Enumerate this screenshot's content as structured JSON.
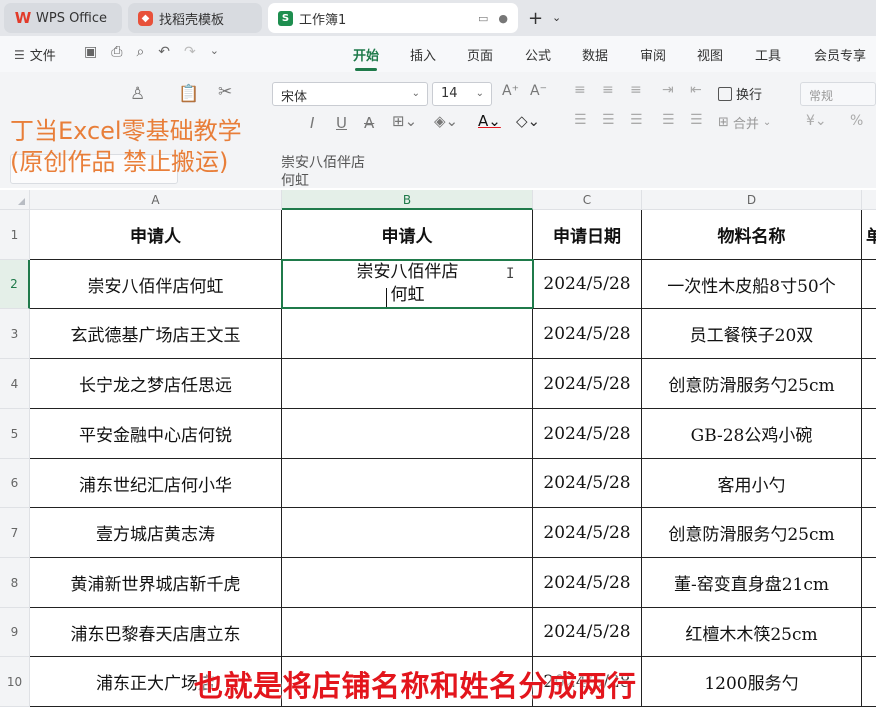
{
  "tabs": {
    "wps": "WPS Office",
    "template": "找稻壳模板",
    "book": "工作簿1",
    "book_icon": "S"
  },
  "menu": {
    "file": "文件",
    "tabs": [
      "开始",
      "插入",
      "页面",
      "公式",
      "数据",
      "审阅",
      "视图",
      "工具",
      "会员专享"
    ],
    "active": "开始"
  },
  "ribbon": {
    "font": "宋体",
    "size": "14",
    "number_format": "常规",
    "wrap_label": "换行",
    "merge_label": "合并",
    "currency": "¥",
    "percent": "%"
  },
  "watermark": {
    "line1": "丁当Excel零基础教学",
    "line2": "(原创作品 禁止搬运)"
  },
  "formula_bar": {
    "content": "崇安八佰伴店\n何虹"
  },
  "grid": {
    "columns": [
      "A",
      "B",
      "C",
      "D"
    ],
    "selected_column": "B",
    "selected_row": "2",
    "rows": [
      {
        "num": "1",
        "cells": [
          "申请人",
          "申请人",
          "申请日期",
          "物料名称",
          "单"
        ]
      },
      {
        "num": "2",
        "cells": [
          "崇安八佰伴店何虹",
          "崇安八佰伴店\n何虹",
          "2024/5/28",
          "一次性木皮船8寸50个",
          ""
        ]
      },
      {
        "num": "3",
        "cells": [
          "玄武德基广场店王文玉",
          "",
          "2024/5/28",
          "员工餐筷子20双",
          ""
        ]
      },
      {
        "num": "4",
        "cells": [
          "长宁龙之梦店任思远",
          "",
          "2024/5/28",
          "创意防滑服务勺25cm",
          ""
        ]
      },
      {
        "num": "5",
        "cells": [
          "平安金融中心店何锐",
          "",
          "2024/5/28",
          "GB-28公鸡小碗",
          ""
        ]
      },
      {
        "num": "6",
        "cells": [
          "浦东世纪汇店何小华",
          "",
          "2024/5/28",
          "客用小勺",
          ""
        ]
      },
      {
        "num": "7",
        "cells": [
          "壹方城店黄志涛",
          "",
          "2024/5/28",
          "创意防滑服务勺25cm",
          ""
        ]
      },
      {
        "num": "8",
        "cells": [
          "黄浦新世界城店靳千虎",
          "",
          "2024/5/28",
          "董-窑变直身盘21cm",
          ""
        ]
      },
      {
        "num": "9",
        "cells": [
          "浦东巴黎春天店唐立东",
          "",
          "2024/5/28",
          "红檀木木筷25cm",
          ""
        ]
      },
      {
        "num": "10",
        "cells": [
          "浦东正大广场店",
          "",
          "2024/5/28",
          "1200服务勺",
          ""
        ]
      }
    ]
  },
  "subtitle": "也就是将店铺名称和姓名分成两行",
  "colors": {
    "accent": "#1f7a4a",
    "subtitle": "#e3151c",
    "watermark": "#e8752a"
  }
}
